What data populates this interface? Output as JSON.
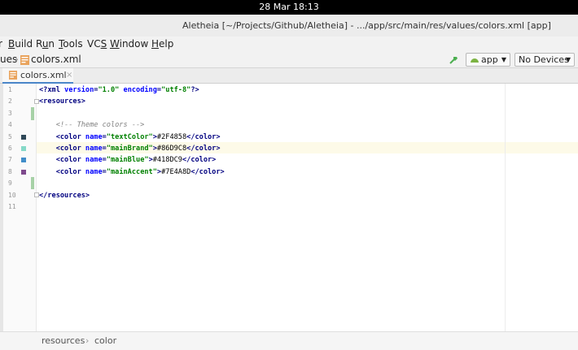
{
  "system": {
    "clock": "28 Mar  18:13"
  },
  "window": {
    "title": "Aletheia [~/Projects/Github/Aletheia] - .../app/src/main/res/values/colors.xml [app]"
  },
  "menu": {
    "items": [
      {
        "label_pre": "",
        "label_u": "B",
        "label_post": "uild"
      },
      {
        "label_pre": "R",
        "label_u": "u",
        "label_post": "n"
      },
      {
        "label_pre": "",
        "label_u": "T",
        "label_post": "ools"
      },
      {
        "label_pre": "VC",
        "label_u": "S",
        "label_post": ""
      },
      {
        "label_pre": "",
        "label_u": "W",
        "label_post": "indow"
      },
      {
        "label_pre": "",
        "label_u": "H",
        "label_post": "elp"
      }
    ]
  },
  "nav": {
    "prev_crumb": "ues",
    "separator": "›",
    "file_crumb": "colors.xml",
    "config": "app",
    "device": "No Devices",
    "dropdown_arrow": "▼"
  },
  "tabs": [
    {
      "label": "colors.xml",
      "close": "×"
    }
  ],
  "editor": {
    "line_numbers": [
      "1",
      "2",
      "3",
      "4",
      "5",
      "6",
      "7",
      "8",
      "9",
      "10",
      "11"
    ],
    "lines": [
      [
        {
          "c": "tag",
          "t": "<?xml "
        },
        {
          "c": "attr",
          "t": "version"
        },
        {
          "c": "tag",
          "t": "="
        },
        {
          "c": "str",
          "t": "\"1.0\""
        },
        {
          "c": "tag",
          "t": " "
        },
        {
          "c": "attr",
          "t": "encoding"
        },
        {
          "c": "tag",
          "t": "="
        },
        {
          "c": "str",
          "t": "\"utf-8\""
        },
        {
          "c": "tag",
          "t": "?>"
        }
      ],
      [
        {
          "c": "tag",
          "t": "<resources>"
        }
      ],
      [],
      [
        {
          "c": "comment",
          "t": "    <!-- Theme colors -->"
        }
      ],
      [
        {
          "c": "plain",
          "t": "    "
        },
        {
          "c": "tag",
          "t": "<color "
        },
        {
          "c": "attr",
          "t": "name"
        },
        {
          "c": "tag",
          "t": "="
        },
        {
          "c": "str",
          "t": "\"textColor\""
        },
        {
          "c": "tag",
          "t": ">"
        },
        {
          "c": "plain",
          "t": "#2F4858"
        },
        {
          "c": "tag",
          "t": "</color>"
        }
      ],
      [
        {
          "c": "plain",
          "t": "    "
        },
        {
          "c": "tag",
          "t": "<color "
        },
        {
          "c": "attr",
          "t": "name"
        },
        {
          "c": "tag",
          "t": "="
        },
        {
          "c": "str",
          "t": "\"mainBrand\""
        },
        {
          "c": "tag",
          "t": ">"
        },
        {
          "c": "plain",
          "t": "#86D9C8"
        },
        {
          "c": "tag",
          "t": "</color>"
        }
      ],
      [
        {
          "c": "plain",
          "t": "    "
        },
        {
          "c": "tag",
          "t": "<color "
        },
        {
          "c": "attr",
          "t": "name"
        },
        {
          "c": "tag",
          "t": "="
        },
        {
          "c": "str",
          "t": "\"mainBlue\""
        },
        {
          "c": "tag",
          "t": ">"
        },
        {
          "c": "plain",
          "t": "#418DC9"
        },
        {
          "c": "tag",
          "t": "</color>"
        }
      ],
      [
        {
          "c": "plain",
          "t": "    "
        },
        {
          "c": "tag",
          "t": "<color "
        },
        {
          "c": "attr",
          "t": "name"
        },
        {
          "c": "tag",
          "t": "="
        },
        {
          "c": "str",
          "t": "\"mainAccent\""
        },
        {
          "c": "tag",
          "t": ">"
        },
        {
          "c": "plain",
          "t": "#7E4A8D"
        },
        {
          "c": "tag",
          "t": "</color>"
        }
      ],
      [],
      [
        {
          "c": "tag",
          "t": "</resources>"
        }
      ],
      []
    ],
    "swatches": [
      {
        "line": 5,
        "color": "#2F4858"
      },
      {
        "line": 6,
        "color": "#86D9C8"
      },
      {
        "line": 7,
        "color": "#418DC9"
      },
      {
        "line": 8,
        "color": "#7E4A8D"
      }
    ],
    "current_line": 6
  },
  "breadcrumb": {
    "items": [
      "resources",
      "color"
    ],
    "separator": "›"
  }
}
